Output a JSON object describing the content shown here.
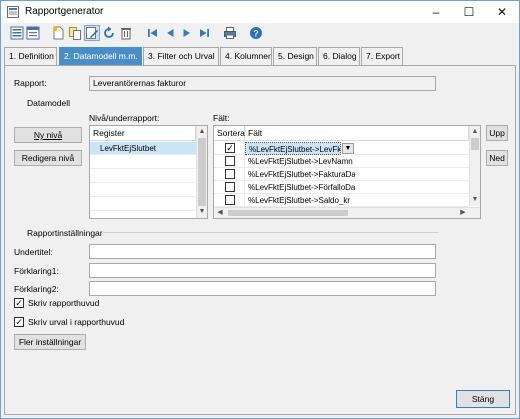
{
  "window": {
    "title": "Rapportgenerator"
  },
  "tabs": [
    "1. Definition",
    "2. Datamodell m.m.",
    "3. Filter och Urval",
    "4. Kolumner",
    "5. Design",
    "6. Dialog",
    "7. Export"
  ],
  "report": {
    "label": "Rapport:",
    "value": "Leverantörernas fakturor"
  },
  "datamodel": {
    "section_label": "Datamodell",
    "level_label": "Nivå/underrapport:",
    "fields_label": "Fält:",
    "new_level_button": "Ny nivå",
    "edit_level_button": "Redigera nivå",
    "register": {
      "header": "Register",
      "rows": [
        "LevFktEjSlutbet"
      ]
    },
    "fields": {
      "header_sort": "Sortera",
      "header_field": "Fält",
      "rows": [
        {
          "checked": true,
          "field": "%LevFktEjSlutbet->LevFkt"
        },
        {
          "checked": false,
          "field": "%LevFktEjSlutbet->LevNamn"
        },
        {
          "checked": false,
          "field": "%LevFktEjSlutbet->FakturaDa"
        },
        {
          "checked": false,
          "field": "%LevFktEjSlutbet->FörfalloDat"
        },
        {
          "checked": false,
          "field": "%LevFktEjSlutbet->Saldo_kr"
        }
      ]
    },
    "up_button": "Upp",
    "down_button": "Ned"
  },
  "report_settings": {
    "section_label": "Rapportinställningar",
    "subtitle_label": "Undertitel:",
    "subtitle_value": "",
    "expl1_label": "Förklaring1:",
    "expl1_value": "",
    "expl2_label": "Förklaring2:",
    "expl2_value": "",
    "print_header_label": "Skriv rapporthuvud",
    "print_header_checked": true,
    "print_selection_label": "Skriv urval i rapporthuvud",
    "print_selection_checked": true,
    "more_settings_button": "Fler inställningar"
  },
  "close_button": "Stäng",
  "colors": {
    "active_tab": "#4a8ec9",
    "selection": "#cce4f7"
  }
}
